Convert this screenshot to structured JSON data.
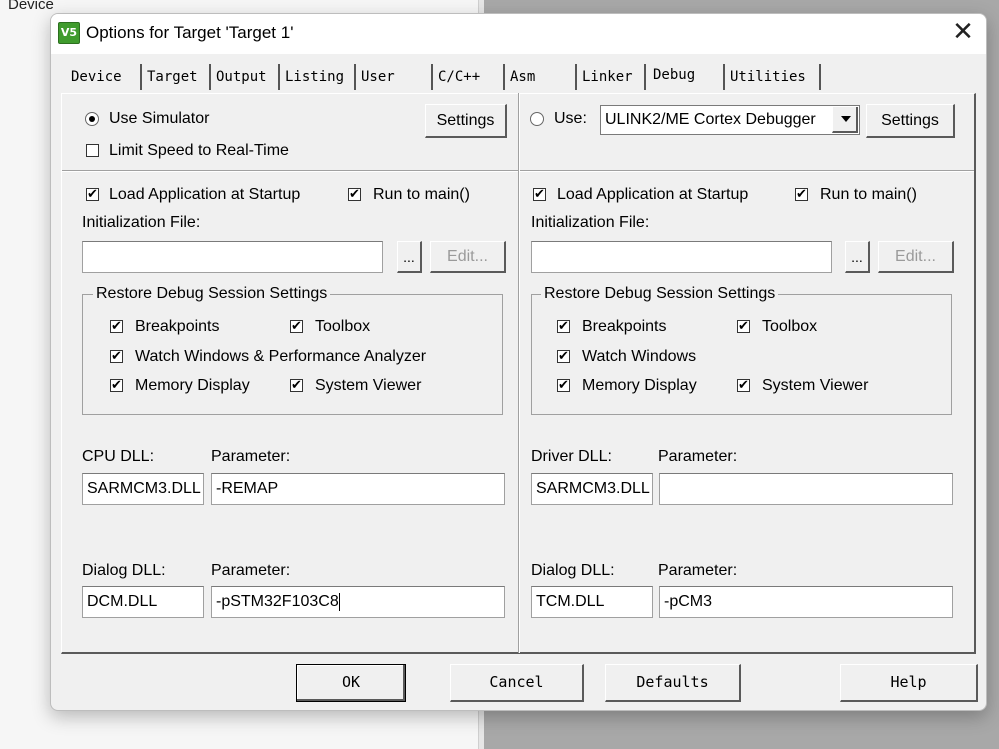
{
  "background": {
    "device_label": "Device"
  },
  "dialog": {
    "icon_text": "V5",
    "title": "Options for Target 'Target 1'"
  },
  "tabs": [
    "Device",
    "Target",
    "Output",
    "Listing",
    "User",
    "C/C++",
    "Asm",
    "Linker",
    "Debug",
    "Utilities"
  ],
  "active_tab": "Debug",
  "left": {
    "use_simulator_label": "Use Simulator",
    "use_simulator_selected": true,
    "settings_label": "Settings",
    "limit_speed_label": "Limit Speed to Real-Time",
    "limit_speed_checked": false,
    "load_app_label": "Load Application at Startup",
    "run_to_main_label": "Run to main()",
    "init_file_label": "Initialization File:",
    "init_file_value": "",
    "browse_label": "...",
    "edit_label": "Edit...",
    "restore_title": "Restore Debug Session Settings",
    "restore": {
      "breakpoints": "Breakpoints",
      "toolbox": "Toolbox",
      "watch": "Watch Windows & Performance Analyzer",
      "memory": "Memory Display",
      "system_viewer": "System Viewer"
    },
    "dll1_label": "CPU DLL:",
    "dll1_value": "SARMCM3.DLL",
    "param1_label": "Parameter:",
    "param1_value": "-REMAP",
    "dll2_label": "Dialog DLL:",
    "dll2_value": "DCM.DLL",
    "param2_label": "Parameter:",
    "param2_value": "-pSTM32F103C8"
  },
  "right": {
    "use_label": "Use:",
    "use_selected": false,
    "debugger_value": "ULINK2/ME Cortex Debugger",
    "settings_label": "Settings",
    "load_app_label": "Load Application at Startup",
    "run_to_main_label": "Run to main()",
    "init_file_label": "Initialization File:",
    "init_file_value": "",
    "browse_label": "...",
    "edit_label": "Edit...",
    "restore_title": "Restore Debug Session Settings",
    "restore": {
      "breakpoints": "Breakpoints",
      "toolbox": "Toolbox",
      "watch": "Watch Windows",
      "memory": "Memory Display",
      "system_viewer": "System Viewer"
    },
    "dll1_label": "Driver DLL:",
    "dll1_value": "SARMCM3.DLL",
    "param1_label": "Parameter:",
    "param1_value": "",
    "dll2_label": "Dialog DLL:",
    "dll2_value": "TCM.DLL",
    "param2_label": "Parameter:",
    "param2_value": "-pCM3"
  },
  "buttons": {
    "ok": "OK",
    "cancel": "Cancel",
    "defaults": "Defaults",
    "help": "Help"
  },
  "icons": {
    "check": "✔",
    "close": "✕"
  }
}
